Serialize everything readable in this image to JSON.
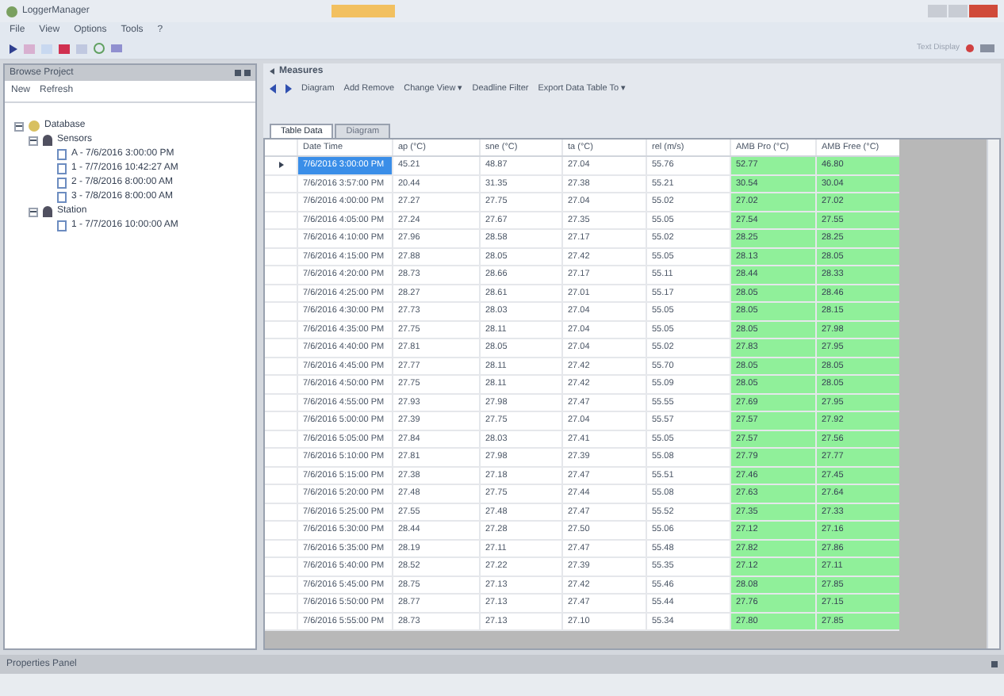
{
  "window": {
    "title": "LoggerManager"
  },
  "menu": [
    "File",
    "View",
    "Options",
    "Tools",
    "?"
  ],
  "top_right": {
    "label": "Text Display"
  },
  "browse_panel": {
    "title": "Browse Project",
    "buttons": [
      "New",
      "Refresh"
    ],
    "tree": [
      {
        "label": "Database",
        "expanded": true,
        "children": [
          {
            "label": "Sensors",
            "expanded": true,
            "children": [
              {
                "label": "A - 7/6/2016 3:00:00 PM"
              },
              {
                "label": "1 - 7/7/2016 10:42:27 AM"
              },
              {
                "label": "2 - 7/8/2016 8:00:00 AM"
              },
              {
                "label": "3 - 7/8/2016 8:00:00 AM"
              }
            ]
          },
          {
            "label": "Station",
            "expanded": true,
            "children": [
              {
                "label": "1 - 7/7/2016 10:00:00 AM"
              }
            ]
          }
        ]
      }
    ]
  },
  "document": {
    "title": "Measures",
    "toolbar": [
      "Diagram",
      "Add Remove",
      "Change View ▾",
      "Deadline Filter",
      "Export Data Table To ▾"
    ],
    "tabs": [
      {
        "label": "Table Data",
        "selected": true
      },
      {
        "label": "Diagram",
        "selected": false
      }
    ],
    "table": {
      "columns": [
        "Date Time",
        "ap (°C)",
        "sne (°C)",
        "ta (°C)",
        "rel (m/s)",
        "AMB Pro (°C)",
        "AMB Free (°C)"
      ],
      "rows": [
        {
          "selected": true,
          "cells": [
            "7/6/2016 3:00:00 PM",
            "45.21",
            "48.87",
            "27.04",
            "55.76",
            "52.77",
            "46.80"
          ]
        },
        {
          "selected": false,
          "cells": [
            "7/6/2016 3:57:00 PM",
            "20.44",
            "31.35",
            "27.38",
            "55.21",
            "30.54",
            "30.04"
          ]
        },
        {
          "selected": false,
          "cells": [
            "7/6/2016 4:00:00 PM",
            "27.27",
            "27.75",
            "27.04",
            "55.02",
            "27.02",
            "27.02"
          ]
        },
        {
          "selected": false,
          "cells": [
            "7/6/2016 4:05:00 PM",
            "27.24",
            "27.67",
            "27.35",
            "55.05",
            "27.54",
            "27.55"
          ]
        },
        {
          "selected": false,
          "cells": [
            "7/6/2016 4:10:00 PM",
            "27.96",
            "28.58",
            "27.17",
            "55.02",
            "28.25",
            "28.25"
          ]
        },
        {
          "selected": false,
          "cells": [
            "7/6/2016 4:15:00 PM",
            "27.88",
            "28.05",
            "27.42",
            "55.05",
            "28.13",
            "28.05"
          ]
        },
        {
          "selected": false,
          "cells": [
            "7/6/2016 4:20:00 PM",
            "28.73",
            "28.66",
            "27.17",
            "55.11",
            "28.44",
            "28.33"
          ]
        },
        {
          "selected": false,
          "cells": [
            "7/6/2016 4:25:00 PM",
            "28.27",
            "28.61",
            "27.01",
            "55.17",
            "28.05",
            "28.46"
          ]
        },
        {
          "selected": false,
          "cells": [
            "7/6/2016 4:30:00 PM",
            "27.73",
            "28.03",
            "27.04",
            "55.05",
            "28.05",
            "28.15"
          ]
        },
        {
          "selected": false,
          "cells": [
            "7/6/2016 4:35:00 PM",
            "27.75",
            "28.11",
            "27.04",
            "55.05",
            "28.05",
            "27.98"
          ]
        },
        {
          "selected": false,
          "cells": [
            "7/6/2016 4:40:00 PM",
            "27.81",
            "28.05",
            "27.04",
            "55.02",
            "27.83",
            "27.95"
          ]
        },
        {
          "selected": false,
          "cells": [
            "7/6/2016 4:45:00 PM",
            "27.77",
            "28.11",
            "27.42",
            "55.70",
            "28.05",
            "28.05"
          ]
        },
        {
          "selected": false,
          "cells": [
            "7/6/2016 4:50:00 PM",
            "27.75",
            "28.11",
            "27.42",
            "55.09",
            "28.05",
            "28.05"
          ]
        },
        {
          "selected": false,
          "cells": [
            "7/6/2016 4:55:00 PM",
            "27.93",
            "27.98",
            "27.47",
            "55.55",
            "27.69",
            "27.95"
          ]
        },
        {
          "selected": false,
          "cells": [
            "7/6/2016 5:00:00 PM",
            "27.39",
            "27.75",
            "27.04",
            "55.57",
            "27.57",
            "27.92"
          ]
        },
        {
          "selected": false,
          "cells": [
            "7/6/2016 5:05:00 PM",
            "27.84",
            "28.03",
            "27.41",
            "55.05",
            "27.57",
            "27.56"
          ]
        },
        {
          "selected": false,
          "cells": [
            "7/6/2016 5:10:00 PM",
            "27.81",
            "27.98",
            "27.39",
            "55.08",
            "27.79",
            "27.77"
          ]
        },
        {
          "selected": false,
          "cells": [
            "7/6/2016 5:15:00 PM",
            "27.38",
            "27.18",
            "27.47",
            "55.51",
            "27.46",
            "27.45"
          ]
        },
        {
          "selected": false,
          "cells": [
            "7/6/2016 5:20:00 PM",
            "27.48",
            "27.75",
            "27.44",
            "55.08",
            "27.63",
            "27.64"
          ]
        },
        {
          "selected": false,
          "cells": [
            "7/6/2016 5:25:00 PM",
            "27.55",
            "27.48",
            "27.47",
            "55.52",
            "27.35",
            "27.33"
          ]
        },
        {
          "selected": false,
          "cells": [
            "7/6/2016 5:30:00 PM",
            "28.44",
            "27.28",
            "27.50",
            "55.06",
            "27.12",
            "27.16"
          ]
        },
        {
          "selected": false,
          "cells": [
            "7/6/2016 5:35:00 PM",
            "28.19",
            "27.11",
            "27.47",
            "55.48",
            "27.82",
            "27.86"
          ]
        },
        {
          "selected": false,
          "cells": [
            "7/6/2016 5:40:00 PM",
            "28.52",
            "27.22",
            "27.39",
            "55.35",
            "27.12",
            "27.11"
          ]
        },
        {
          "selected": false,
          "cells": [
            "7/6/2016 5:45:00 PM",
            "28.75",
            "27.13",
            "27.42",
            "55.46",
            "28.08",
            "27.85"
          ]
        },
        {
          "selected": false,
          "cells": [
            "7/6/2016 5:50:00 PM",
            "28.77",
            "27.13",
            "27.47",
            "55.44",
            "27.76",
            "27.15"
          ]
        },
        {
          "selected": false,
          "cells": [
            "7/6/2016 5:55:00 PM",
            "28.73",
            "27.13",
            "27.10",
            "55.34",
            "27.80",
            "27.85"
          ]
        }
      ]
    }
  },
  "properties_panel": {
    "title": "Properties Panel"
  }
}
